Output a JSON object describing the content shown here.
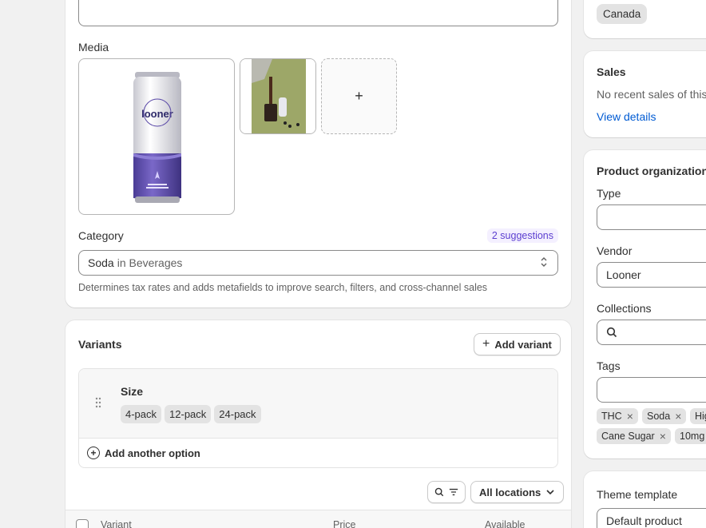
{
  "media": {
    "label": "Media",
    "add_symbol": "+"
  },
  "category": {
    "label": "Category",
    "suggestions": "2 suggestions",
    "value": "Soda",
    "path": "in Beverages",
    "help": "Determines tax rates and adds metafields to improve search, filters, and cross-channel sales"
  },
  "variants": {
    "title": "Variants",
    "add_variant": "Add variant",
    "option_name": "Size",
    "option_values": [
      "4-pack",
      "12-pack",
      "24-pack"
    ],
    "add_another_option": "Add another option",
    "locations": "All locations",
    "columns": [
      "Variant",
      "Price",
      "Available"
    ]
  },
  "markets": {
    "chip": "Canada"
  },
  "sales": {
    "title": "Sales",
    "text": "No recent sales of this",
    "link": "View details"
  },
  "org": {
    "title": "Product organization",
    "type_label": "Type",
    "type_value": "",
    "vendor_label": "Vendor",
    "vendor_value": "Looner",
    "collections_label": "Collections",
    "tags_label": "Tags",
    "tags": [
      "THC",
      "Soda",
      "Hig",
      "Cane Sugar",
      "10mg"
    ]
  },
  "theme": {
    "label": "Theme template",
    "value": "Default product"
  },
  "colors": {
    "accent_link": "#005bd3",
    "suggest_purple": "#5c3fd0",
    "can_purple": "#5b4aa8"
  }
}
